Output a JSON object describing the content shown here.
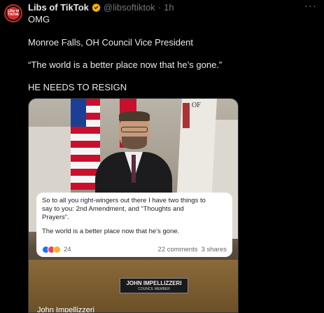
{
  "post": {
    "avatar_label": "Libs of TikTok",
    "display_name": "Libs of TikTok",
    "handle": "@libsoftiktok",
    "separator": "·",
    "time": "1h",
    "more_icon": "more-icon",
    "verified_icon": "verified-badge-icon",
    "colors": {
      "verified": "#f4b400",
      "handle": "#71767b",
      "background": "#000000"
    },
    "lines": [
      "OMG",
      "Monroe Falls, OH Council Vice President",
      "“The world is a better place now that he’s gone.”",
      "HE NEEDS TO RESIGN"
    ]
  },
  "media": {
    "flag_text": "OF",
    "nameplate_name": "JOHN IMPELLIZZERI",
    "nameplate_title": "COUNCIL MEMBER",
    "caption": "John Impellizzeri",
    "fb_card": {
      "lines": [
        "So to all you right-wingers out there I have two things to",
        "say to you:  2nd Amendment, and “Thoughts and",
        "Prayers”."
      ],
      "quote": "The world is a better place now that he’s gone.",
      "reaction_count": "24",
      "comments": "22 comments",
      "shares": "3 shares",
      "reaction_icons": [
        "like-icon",
        "love-icon",
        "care-icon"
      ]
    }
  }
}
